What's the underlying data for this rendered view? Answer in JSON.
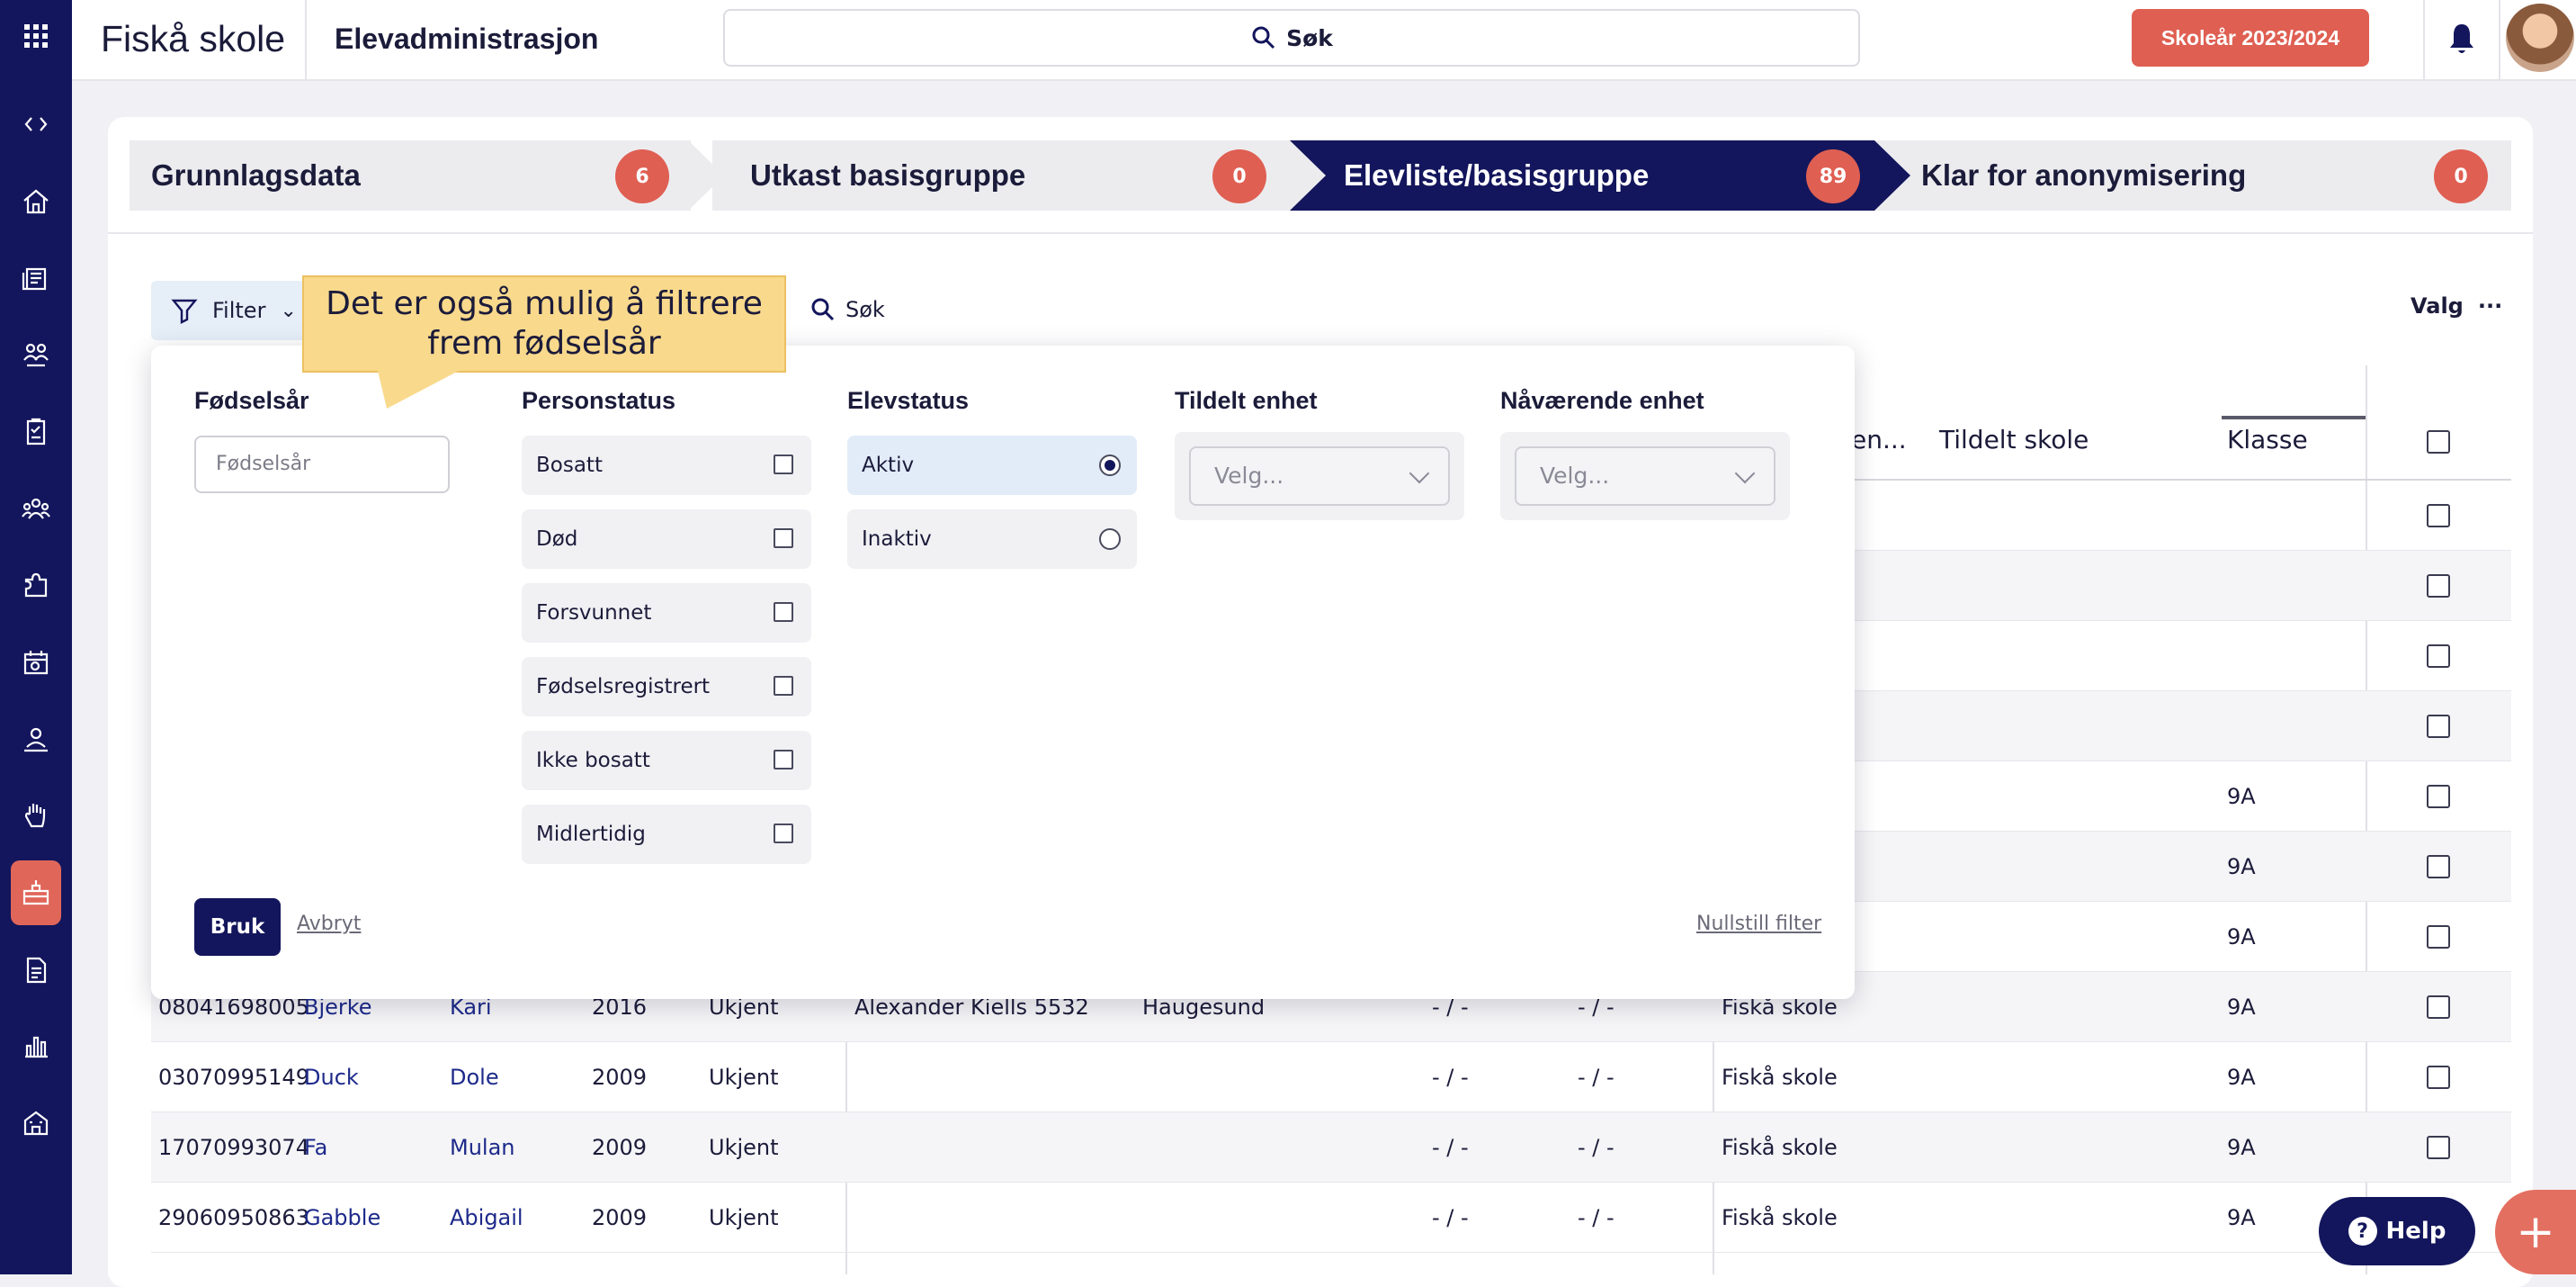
{
  "app": {
    "school": "Fiskå skole",
    "module": "Elevadministrasjon",
    "search_label": "Søk",
    "school_year": "Skoleår 2023/2024"
  },
  "sidebar": {
    "icons": [
      "apps-grid-icon",
      "code-toggle-icon",
      "home-icon",
      "news-icon",
      "group-icon",
      "checklist-icon",
      "people-icon",
      "puzzle-icon",
      "calendar-icon",
      "person-icon",
      "hand-icon",
      "school-admin-icon",
      "document-icon",
      "bar-chart-icon",
      "building-icon"
    ],
    "active_index": 11
  },
  "steps": [
    {
      "label": "Grunnlagsdata",
      "count": "6"
    },
    {
      "label": "Utkast basisgruppe",
      "count": "0"
    },
    {
      "label": "Elevliste/basisgruppe",
      "count": "89"
    },
    {
      "label": "Klar for anonymisering",
      "count": "0"
    }
  ],
  "toolbar": {
    "filter_label": "Filter",
    "search_label": "Søk",
    "valg_label": "Valg",
    "valg_more": "···"
  },
  "tooltip": {
    "text": "Det er også mulig å filtrere frem fødselsår"
  },
  "filter_panel": {
    "fodselsar": {
      "heading": "Fødselsår",
      "placeholder": "Fødselsår"
    },
    "personstatus": {
      "heading": "Personstatus",
      "options": [
        "Bosatt",
        "Død",
        "Forsvunnet",
        "Fødselsregistrert",
        "Ikke bosatt",
        "Midlertidig"
      ]
    },
    "elevstatus": {
      "heading": "Elevstatus",
      "options": [
        {
          "label": "Aktiv",
          "selected": true
        },
        {
          "label": "Inaktiv",
          "selected": false
        }
      ]
    },
    "tildelt_enhet": {
      "heading": "Tildelt enhet",
      "placeholder": "Velg..."
    },
    "navaerende_enhet": {
      "heading": "Nåværende enhet",
      "placeholder": "Velg..."
    },
    "apply_label": "Bruk",
    "cancel_label": "Avbryt",
    "reset_label": "Nullstill filter"
  },
  "table": {
    "headers": {
      "partial": "en...",
      "tildelt_skole": "Tildelt skole",
      "klasse": "Klasse"
    },
    "hidden_rows": [
      {
        "klasse": ""
      },
      {
        "klasse": ""
      },
      {
        "klasse": ""
      },
      {
        "klasse": ""
      },
      {
        "klasse": "9A"
      },
      {
        "klasse": "9A"
      },
      {
        "klasse": "9A"
      }
    ],
    "rows": [
      {
        "id": "08041698005",
        "last": "Bjerke",
        "first": "Kari",
        "year": "2016",
        "status": "Ukjent",
        "address": "Alexander Kiells 5532",
        "city": "Haugesund",
        "c1": "- / -",
        "c2": "- / -",
        "school": "Fiskå skole",
        "klasse": "9A"
      },
      {
        "id": "03070995149",
        "last": "Duck",
        "first": "Dole",
        "year": "2009",
        "status": "Ukjent",
        "address": "",
        "city": "",
        "c1": "- / -",
        "c2": "- / -",
        "school": "Fiskå skole",
        "klasse": "9A"
      },
      {
        "id": "17070993074",
        "last": "Fa",
        "first": "Mulan",
        "year": "2009",
        "status": "Ukjent",
        "address": "",
        "city": "",
        "c1": "- / -",
        "c2": "- / -",
        "school": "Fiskå skole",
        "klasse": "9A"
      },
      {
        "id": "29060950863",
        "last": "Gabble",
        "first": "Abigail",
        "year": "2009",
        "status": "Ukjent",
        "address": "",
        "city": "",
        "c1": "- / -",
        "c2": "- / -",
        "school": "Fiskå skole",
        "klasse": "9A"
      }
    ]
  },
  "help": {
    "label": "Help",
    "q": "?"
  },
  "fab": {
    "label": "+"
  }
}
